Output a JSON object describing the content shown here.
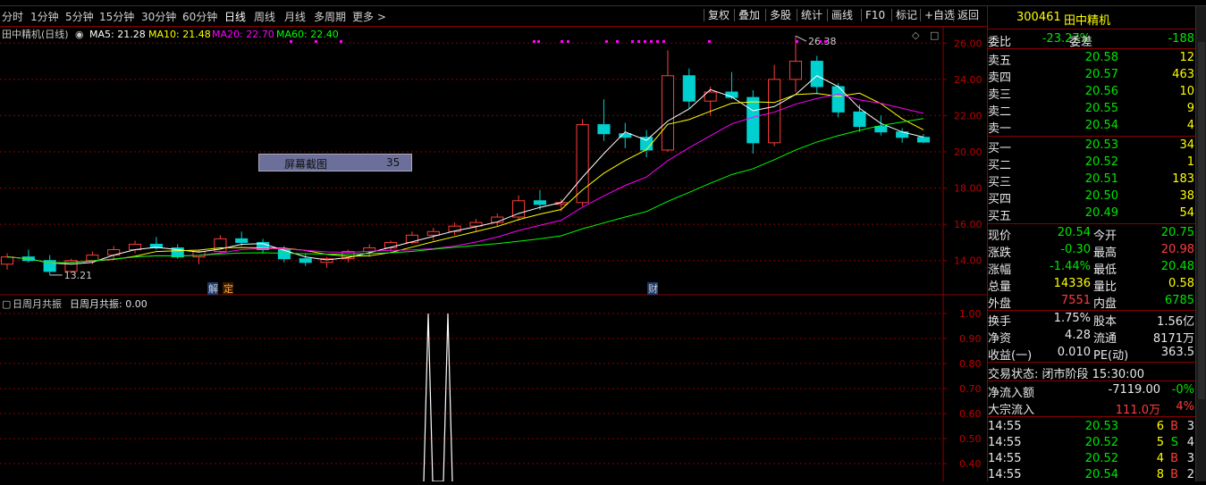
{
  "toolbar": {
    "timeframes": [
      "分时",
      "1分钟",
      "5分钟",
      "15分钟",
      "30分钟",
      "60分钟",
      "日线",
      "周线",
      "月线",
      "多周期",
      "更多 >"
    ],
    "active_timeframe": "日线",
    "buttons": [
      "复权",
      "叠加",
      "多股",
      "统计",
      "画线",
      "F10",
      "标记",
      "+自选",
      "返回"
    ]
  },
  "main_chart": {
    "legend": {
      "name": "田中精机(日线)",
      "ma5": "MA5: 21.28",
      "ma10": "MA10: 21.48",
      "ma20": "MA20: 22.70",
      "ma60": "MA60: 22.40"
    },
    "y_ticks": [
      "26.00",
      "24.00",
      "22.00",
      "20.00",
      "18.00",
      "16.00",
      "14.00"
    ],
    "high_label": "26.38",
    "low_label": "13.21",
    "markers": [
      "解",
      "定",
      "财"
    ],
    "tooltip": {
      "label": "屏幕截图",
      "value": "35"
    },
    "colors": {
      "up": "#ff3c3c",
      "down": "#00d0d0",
      "ma5": "#ffffff",
      "ma10": "#ffff00",
      "ma20": "#ff00ff",
      "ma60": "#00ff00",
      "grid": "#8b0000"
    }
  },
  "chart_data": {
    "type": "candlestick",
    "ylim": [
      13,
      26.9
    ],
    "ohlc_approx": [
      [
        13.8,
        14.4,
        13.5,
        14.2
      ],
      [
        14.2,
        14.6,
        13.9,
        14.0
      ],
      [
        14.0,
        14.3,
        13.2,
        13.4
      ],
      [
        13.4,
        14.1,
        13.3,
        14.0
      ],
      [
        14.0,
        14.5,
        13.8,
        14.3
      ],
      [
        14.3,
        14.8,
        14.1,
        14.6
      ],
      [
        14.6,
        15.1,
        14.4,
        14.9
      ],
      [
        14.9,
        15.3,
        14.6,
        14.7
      ],
      [
        14.7,
        14.9,
        14.1,
        14.2
      ],
      [
        14.2,
        14.6,
        13.8,
        14.5
      ],
      [
        14.5,
        15.4,
        14.4,
        15.2
      ],
      [
        15.2,
        15.6,
        14.8,
        15.0
      ],
      [
        15.0,
        15.2,
        14.4,
        14.6
      ],
      [
        14.6,
        14.8,
        13.9,
        14.1
      ],
      [
        14.1,
        14.4,
        13.7,
        13.9
      ],
      [
        13.9,
        14.2,
        13.6,
        14.1
      ],
      [
        14.1,
        14.6,
        13.9,
        14.5
      ],
      [
        14.5,
        14.9,
        14.2,
        14.7
      ],
      [
        14.7,
        15.1,
        14.5,
        15.0
      ],
      [
        15.0,
        15.6,
        14.9,
        15.4
      ],
      [
        15.4,
        15.8,
        15.1,
        15.6
      ],
      [
        15.6,
        16.1,
        15.4,
        15.9
      ],
      [
        15.9,
        16.3,
        15.6,
        16.1
      ],
      [
        16.1,
        16.6,
        15.9,
        16.4
      ],
      [
        16.4,
        17.6,
        16.2,
        17.3
      ],
      [
        17.3,
        17.9,
        16.8,
        17.1
      ],
      [
        17.1,
        17.4,
        16.7,
        17.2
      ],
      [
        17.2,
        21.8,
        17.0,
        21.5
      ],
      [
        21.5,
        22.9,
        20.6,
        21.0
      ],
      [
        21.0,
        21.6,
        20.2,
        20.8
      ],
      [
        20.8,
        21.2,
        19.7,
        20.1
      ],
      [
        20.1,
        25.6,
        20.0,
        24.2
      ],
      [
        24.2,
        24.6,
        22.4,
        22.8
      ],
      [
        22.8,
        23.6,
        22.0,
        23.3
      ],
      [
        23.3,
        24.4,
        22.9,
        23.0
      ],
      [
        23.0,
        23.4,
        19.9,
        20.5
      ],
      [
        20.5,
        24.8,
        20.3,
        24.0
      ],
      [
        24.0,
        26.4,
        23.3,
        25.0
      ],
      [
        25.0,
        25.3,
        23.2,
        23.6
      ],
      [
        23.6,
        23.8,
        21.9,
        22.2
      ],
      [
        22.2,
        22.6,
        21.1,
        21.4
      ],
      [
        21.4,
        22.0,
        20.9,
        21.1
      ],
      [
        21.1,
        21.3,
        20.5,
        20.8
      ],
      [
        20.8,
        20.98,
        20.48,
        20.54
      ]
    ]
  },
  "indicator": {
    "title": "日周月共振",
    "value_label": "日周月共振: 0.00",
    "y_ticks": [
      "1.00",
      "0.90",
      "0.80",
      "0.70",
      "0.60",
      "0.50",
      "0.40"
    ]
  },
  "quote": {
    "code": "300461",
    "name": "田中精机",
    "weibi_label": "委比",
    "weibi_value": "-23.27%",
    "weicha_label": "委差",
    "weicha_value": "-188",
    "asks": [
      {
        "label": "卖五",
        "price": "20.58",
        "vol": "12"
      },
      {
        "label": "卖四",
        "price": "20.57",
        "vol": "463"
      },
      {
        "label": "卖三",
        "price": "20.56",
        "vol": "10"
      },
      {
        "label": "卖二",
        "price": "20.55",
        "vol": "9"
      },
      {
        "label": "卖一",
        "price": "20.54",
        "vol": "4"
      }
    ],
    "bids": [
      {
        "label": "买一",
        "price": "20.53",
        "vol": "34"
      },
      {
        "label": "买二",
        "price": "20.52",
        "vol": "1"
      },
      {
        "label": "买三",
        "price": "20.51",
        "vol": "183"
      },
      {
        "label": "买四",
        "price": "20.50",
        "vol": "38"
      },
      {
        "label": "买五",
        "price": "20.49",
        "vol": "54"
      }
    ],
    "stats": [
      {
        "l1": "现价",
        "v1": "20.54",
        "c1": "green",
        "l2": "今开",
        "v2": "20.75",
        "c2": "green"
      },
      {
        "l1": "涨跌",
        "v1": "-0.30",
        "c1": "green",
        "l2": "最高",
        "v2": "20.98",
        "c2": "red"
      },
      {
        "l1": "涨幅",
        "v1": "-1.44%",
        "c1": "green",
        "l2": "最低",
        "v2": "20.48",
        "c2": "green"
      },
      {
        "l1": "总量",
        "v1": "14336",
        "c1": "yellow",
        "l2": "量比",
        "v2": "0.58",
        "c2": "yellow"
      },
      {
        "l1": "外盘",
        "v1": "7551",
        "c1": "red",
        "l2": "内盘",
        "v2": "6785",
        "c2": "green"
      }
    ],
    "stats2": [
      {
        "l1": "换手",
        "v1": "1.75%",
        "l2": "股本",
        "v2": "1.56亿"
      },
      {
        "l1": "净资",
        "v1": "4.28",
        "l2": "流通",
        "v2": "8171万"
      },
      {
        "l1": "收益(一)",
        "v1": "0.010",
        "l2": "PE(动)",
        "v2": "363.5"
      }
    ],
    "status": "交易状态: 闭市阶段 15:30:00",
    "flow": [
      {
        "label": "净流入额",
        "value": "-7119.00",
        "pct": "-0%",
        "vc": "white",
        "pc": "green"
      },
      {
        "label": "大宗流入",
        "value": "111.0万",
        "pct": "4%",
        "vc": "red",
        "pc": "red"
      }
    ],
    "ticks": [
      {
        "time": "14:55",
        "price": "20.53",
        "vol": "6",
        "side": "B",
        "n": "3"
      },
      {
        "time": "14:55",
        "price": "20.52",
        "vol": "5",
        "side": "S",
        "n": "4"
      },
      {
        "time": "14:55",
        "price": "20.52",
        "vol": "4",
        "side": "B",
        "n": "3"
      },
      {
        "time": "14:55",
        "price": "20.54",
        "vol": "8",
        "side": "B",
        "n": "2"
      }
    ]
  }
}
